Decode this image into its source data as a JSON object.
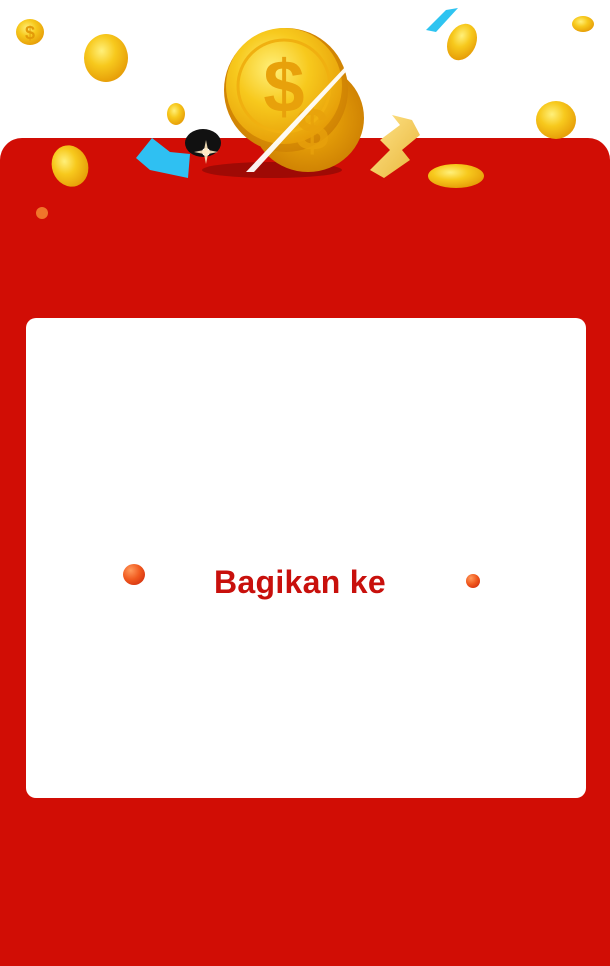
{
  "share": {
    "heading": "Bagikan ke"
  },
  "theme": {
    "panel_color": "#d10d05",
    "card_color": "#ffffff",
    "heading_color": "#c8100c",
    "coin_color": "#f5c21b"
  },
  "icons": {
    "main_coin": "dollar-coin-icon",
    "small_coin": "dollar-coin-icon"
  }
}
